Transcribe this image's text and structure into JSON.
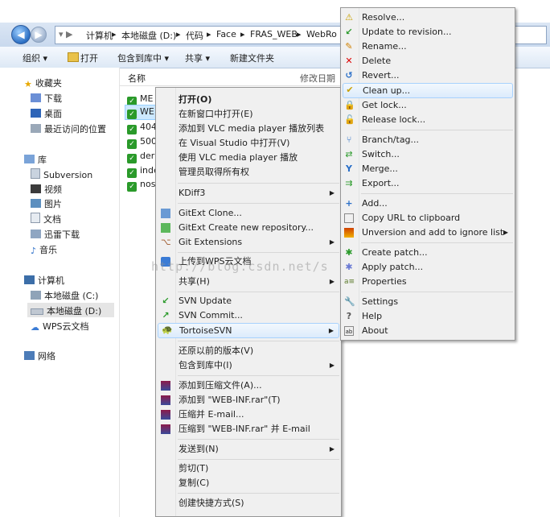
{
  "address": {
    "back_icon": "back-arrow-icon",
    "forward_icon": "forward-arrow-icon",
    "crumbs": [
      "计算机",
      "本地磁盘 (D:)",
      "代码",
      "Face",
      "FRAS_WEB",
      "WebRo"
    ]
  },
  "toolbar": {
    "organize": "组织 ▾",
    "open": "打开",
    "include": "包含到库中 ▾",
    "share": "共享 ▾",
    "new_folder": "新建文件夹"
  },
  "nav": {
    "favorites": "收藏夹",
    "downloads": "下载",
    "desktop": "桌面",
    "recent": "最近访问的位置",
    "libraries": "库",
    "subversion": "Subversion",
    "videos": "视频",
    "pictures": "图片",
    "documents": "文档",
    "xunlei": "迅雷下载",
    "music": "音乐",
    "computer": "计算机",
    "drive_c": "本地磁盘 (C:)",
    "drive_d": "本地磁盘 (D:)",
    "wps": "WPS云文档",
    "network": "网络"
  },
  "columns": {
    "name": "名称",
    "modified": "修改日期"
  },
  "files": [
    "ME",
    "WE",
    "404",
    "500",
    "der",
    "inde",
    "nos"
  ],
  "context_menu": {
    "open": "打开(O)",
    "open_new_window": "在新窗口中打开(E)",
    "vlc_add": "添加到 VLC media player 播放列表",
    "vs_open": "在 Visual Studio 中打开(V)",
    "vlc_play": "使用 VLC media player 播放",
    "admin_owner": "管理员取得所有权",
    "kdiff": "KDiff3",
    "gitext_clone": "GitExt Clone...",
    "gitext_create": "GitExt Create new repository...",
    "git_extensions": "Git Extensions",
    "wps_upload": "上传到WPS云文档",
    "share": "共享(H)",
    "svn_update": "SVN Update",
    "svn_commit": "SVN Commit...",
    "tortoise": "TortoiseSVN",
    "restore": "还原以前的版本(V)",
    "include_lib": "包含到库中(I)",
    "add_archive": "添加到压缩文件(A)...",
    "add_rar": "添加到 \"WEB-INF.rar\"(T)",
    "compress_email": "压缩并 E-mail...",
    "compress_rar_email": "压缩到 \"WEB-INF.rar\" 并 E-mail",
    "send_to": "发送到(N)",
    "cut": "剪切(T)",
    "copy": "复制(C)",
    "shortcut": "创建快捷方式(S)"
  },
  "svn_menu": {
    "resolve": "Resolve...",
    "update_rev": "Update to revision...",
    "rename": "Rename...",
    "delete": "Delete",
    "revert": "Revert...",
    "cleanup": "Clean up...",
    "get_lock": "Get lock...",
    "release_lock": "Release lock...",
    "branch": "Branch/tag...",
    "switch": "Switch...",
    "merge": "Merge...",
    "export": "Export...",
    "add": "Add...",
    "copy_url": "Copy URL to clipboard",
    "unversion": "Unversion and add to ignore list",
    "create_patch": "Create patch...",
    "apply_patch": "Apply patch...",
    "properties": "Properties",
    "settings": "Settings",
    "help": "Help",
    "about": "About"
  },
  "watermark": "http://blog.csdn.net/s",
  "colors": {
    "highlight": "#dcebfc",
    "menu_bg": "#f0f0f0",
    "svn_green": "#2a9a2a"
  }
}
